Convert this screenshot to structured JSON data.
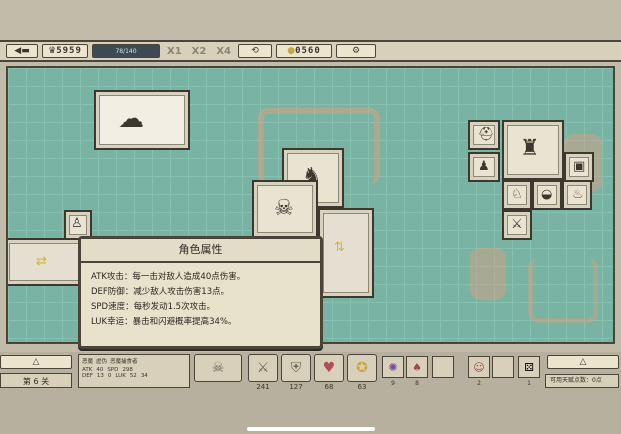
{
  "topbar": {
    "wave": "5959",
    "hp_text": "78/140",
    "speed_buttons": [
      "X1",
      "X2",
      "X4"
    ],
    "gold": "0560"
  },
  "popup": {
    "title": "角色属性",
    "lines": [
      "ATK攻击：每一击对敌人造成40点伤害。",
      "DEF防御：减少敌人攻击伤害13点。",
      "SPD速度：每秒发动1.5次攻击。",
      "LUK幸运：暴击和闪避概率提高34%。"
    ]
  },
  "bottom": {
    "stage": "第 6 关",
    "stat_header": [
      "恶魔",
      "虚伪",
      "恶魔捕食者"
    ],
    "stat_labels": [
      "ATK",
      "SPD",
      "DEF",
      "LUK"
    ],
    "stat_values": [
      "40",
      "298",
      "13",
      "0",
      "52",
      "34"
    ],
    "slots": [
      {
        "icon": "sword-icon",
        "value": "241"
      },
      {
        "icon": "shield-icon",
        "value": "127"
      },
      {
        "icon": "heart-icon",
        "value": "68"
      },
      {
        "icon": "luck-icon",
        "value": "63"
      }
    ],
    "small_values": [
      "9",
      "8",
      "2",
      "1"
    ],
    "talent": "可用天赋点数：0点"
  },
  "colors": {
    "board": "#78b3a3",
    "frame": "#4a4538",
    "panel": "#e8e1cc"
  }
}
